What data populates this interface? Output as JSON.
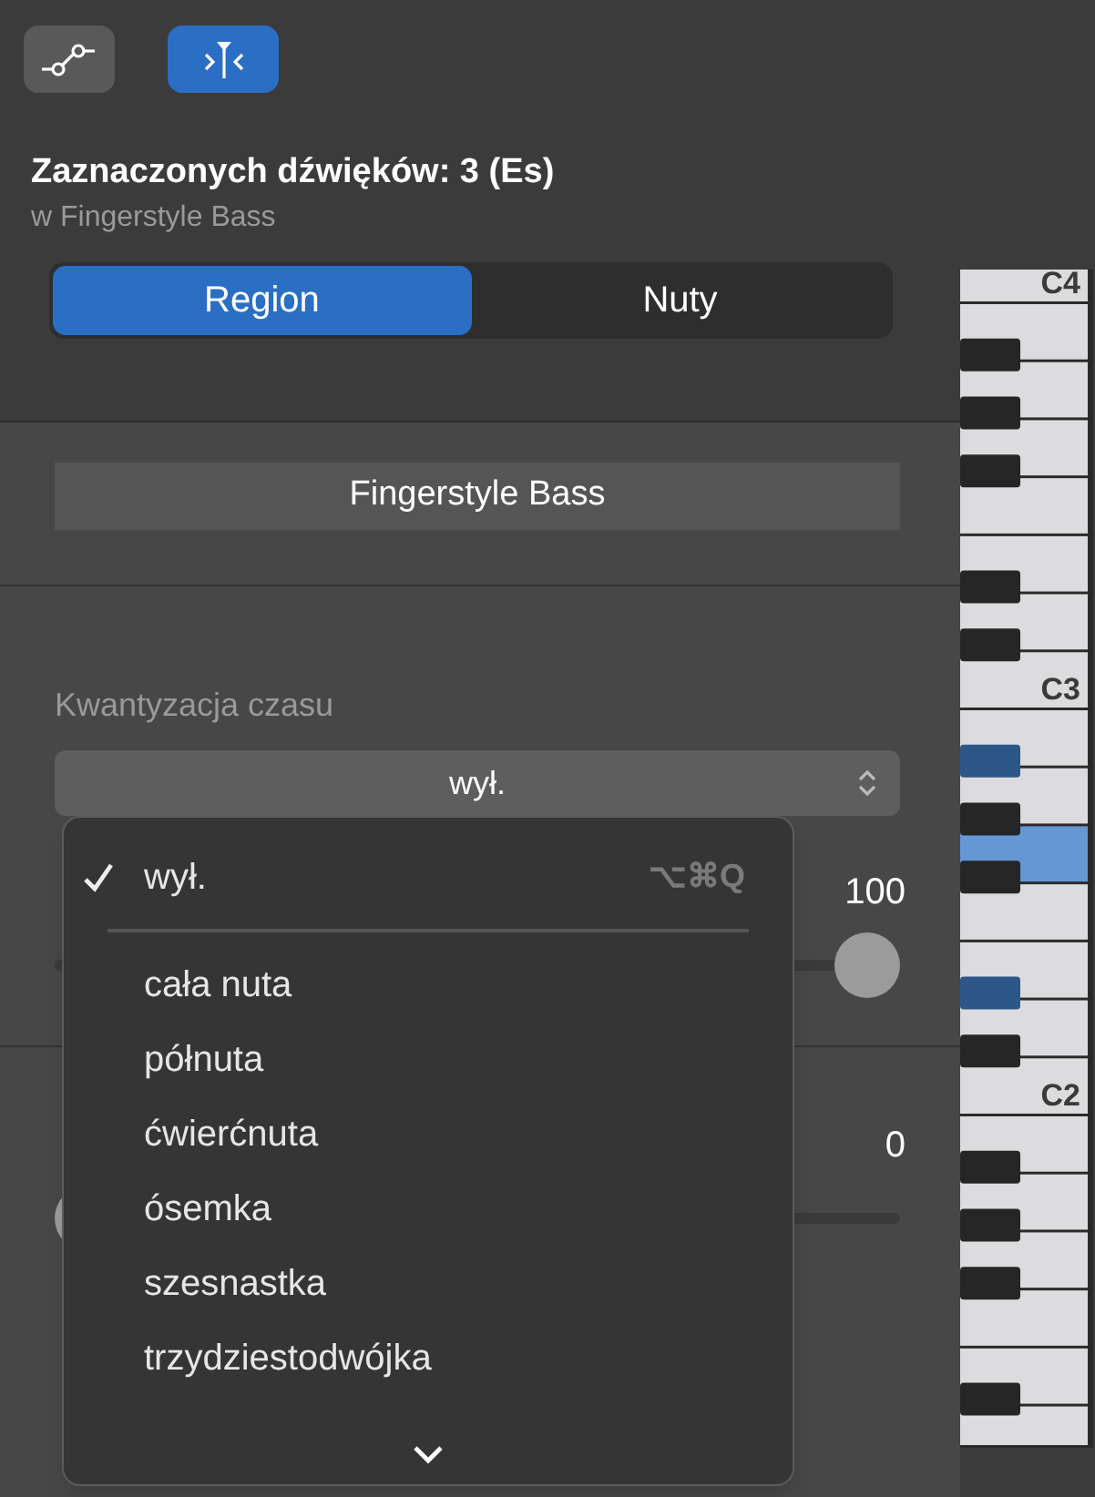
{
  "toolbar": {
    "buttons": [
      {
        "kind": "curve",
        "selected": false
      },
      {
        "kind": "quantize",
        "selected": true
      }
    ]
  },
  "selection": {
    "title": "Zaznaczonych dźwięków: 3 (Es)",
    "subtitle": "w Fingerstyle Bass"
  },
  "segments": [
    {
      "label": "Region",
      "selected": true
    },
    {
      "label": "Nuty",
      "selected": false
    }
  ],
  "region_name": "Fingerstyle Bass",
  "time_quantize": {
    "label": "Kwantyzacja czasu",
    "value": "wył."
  },
  "sliders": [
    {
      "reading": "100",
      "level": 1
    },
    {
      "reading": "0",
      "level": 0
    }
  ],
  "menu": {
    "items": [
      {
        "kind": "option",
        "label": "wył.",
        "checked": true,
        "shortcut": "⌥⌘Q"
      },
      {
        "kind": "separator"
      },
      {
        "kind": "option",
        "label": "cała nuta",
        "checked": false
      },
      {
        "kind": "option",
        "label": "półnuta",
        "checked": false
      },
      {
        "kind": "option",
        "label": "ćwierćnuta",
        "checked": false
      },
      {
        "kind": "option",
        "label": "ósemka",
        "checked": false
      },
      {
        "kind": "option",
        "label": "szesnastka",
        "checked": false
      },
      {
        "kind": "option",
        "label": "trzydziestodwójka",
        "checked": false
      }
    ]
  },
  "keyboard": {
    "keys": [
      {
        "kind": "natural",
        "selected": false,
        "label": "C4"
      },
      {
        "kind": "natural",
        "selected": false
      },
      {
        "kind": "sharp",
        "selected": false
      },
      {
        "kind": "natural",
        "selected": false
      },
      {
        "kind": "sharp",
        "selected": false
      },
      {
        "kind": "natural",
        "selected": false
      },
      {
        "kind": "sharp",
        "selected": false
      },
      {
        "kind": "natural",
        "selected": false
      },
      {
        "kind": "natural",
        "selected": false
      },
      {
        "kind": "sharp",
        "selected": false
      },
      {
        "kind": "natural",
        "selected": false
      },
      {
        "kind": "sharp",
        "selected": false
      },
      {
        "kind": "natural",
        "selected": false,
        "label": "C3"
      },
      {
        "kind": "natural",
        "selected": false
      },
      {
        "kind": "sharp",
        "selected": true
      },
      {
        "kind": "natural",
        "selected": false
      },
      {
        "kind": "sharp",
        "selected": false
      },
      {
        "kind": "natural",
        "selected": true
      },
      {
        "kind": "sharp",
        "selected": false
      },
      {
        "kind": "natural",
        "selected": false
      },
      {
        "kind": "natural",
        "selected": false
      },
      {
        "kind": "sharp",
        "selected": true
      },
      {
        "kind": "natural",
        "selected": false
      },
      {
        "kind": "sharp",
        "selected": false
      },
      {
        "kind": "natural",
        "selected": false,
        "label": "C2"
      },
      {
        "kind": "natural",
        "selected": false
      },
      {
        "kind": "sharp",
        "selected": false
      },
      {
        "kind": "natural",
        "selected": false
      },
      {
        "kind": "sharp",
        "selected": false
      },
      {
        "kind": "natural",
        "selected": false
      },
      {
        "kind": "sharp",
        "selected": false
      },
      {
        "kind": "natural",
        "selected": false
      },
      {
        "kind": "natural",
        "selected": false
      },
      {
        "kind": "sharp",
        "selected": false
      },
      {
        "kind": "natural",
        "selected": false
      }
    ]
  }
}
